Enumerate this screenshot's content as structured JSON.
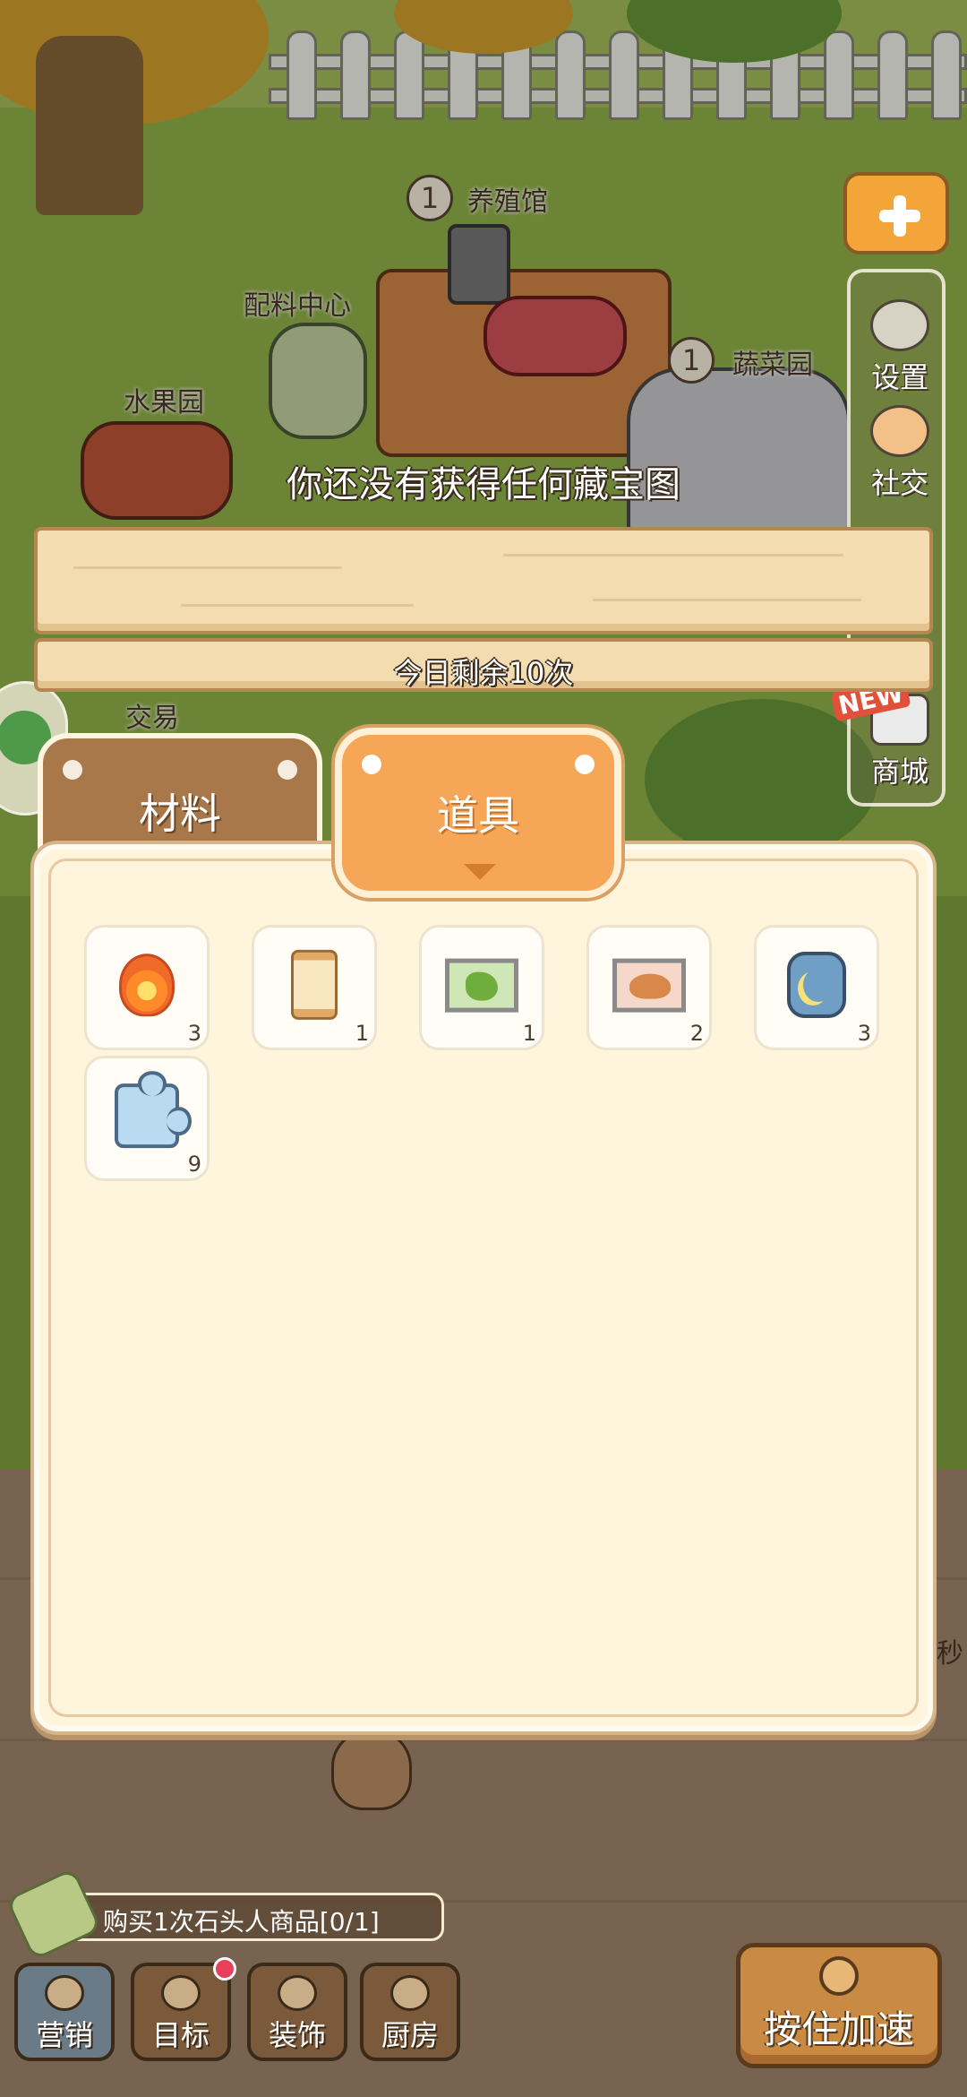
{
  "scene": {
    "buildings": [
      {
        "label": "养殖馆",
        "level": "1"
      },
      {
        "label": "配料中心"
      },
      {
        "label": "水果园"
      },
      {
        "label": "蔬菜园",
        "level": "1"
      },
      {
        "label": "交易"
      }
    ],
    "edge_char": "秒"
  },
  "sidebar": {
    "add_icon": "plus-icon",
    "items": [
      {
        "label": "设置",
        "icon": "gear-icon"
      },
      {
        "label": "社交",
        "icon": "cat-icon"
      },
      {
        "label": "商城",
        "icon": "shop-icon",
        "badge": "NEW"
      }
    ]
  },
  "treasure": {
    "message": "你还没有获得任何藏宝图",
    "remaining": "今日剩余10次"
  },
  "tabs": {
    "materials": "材料",
    "tools": "道具",
    "active": "tools"
  },
  "inventory": {
    "items": [
      {
        "icon": "thermometer-fire-icon",
        "count": "3"
      },
      {
        "icon": "hourglass-icon",
        "count": "1"
      },
      {
        "icon": "vegetable-picture-icon",
        "count": "1"
      },
      {
        "icon": "roast-chicken-picture-icon",
        "count": "2"
      },
      {
        "icon": "moon-stone-icon",
        "count": "3"
      },
      {
        "icon": "puzzle-piece-icon",
        "count": "9"
      }
    ]
  },
  "task": {
    "text": "购买1次石头人商品[0/1]"
  },
  "bottom_bar": {
    "marketing": "营销",
    "goals": "目标",
    "decor": "装饰",
    "kitchen": "厨房",
    "speed_up": "按住加速"
  },
  "colors": {
    "tab_active": "#f6a657",
    "tab_inactive": "#a8774a",
    "panel_bg": "#fef5dc",
    "plank": "#f3ddb0"
  }
}
